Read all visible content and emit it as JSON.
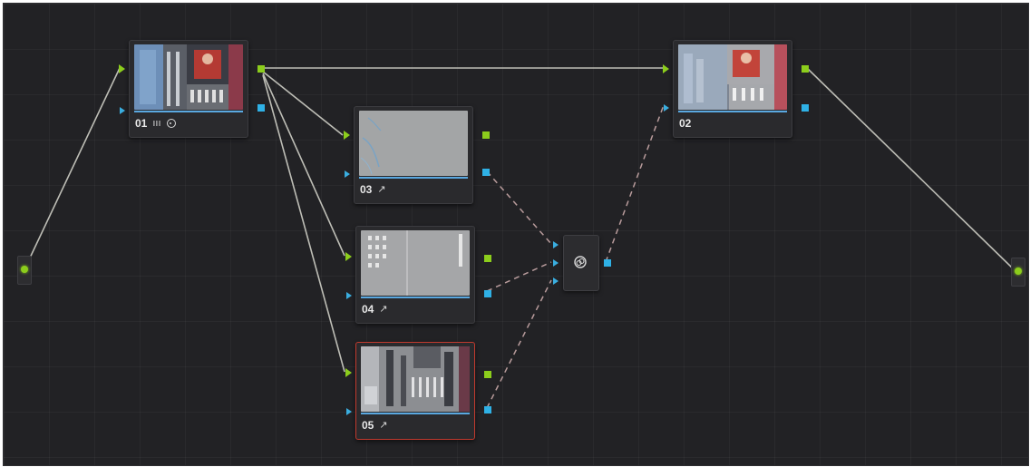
{
  "nodes": [
    {
      "id": "01",
      "number": "01",
      "icons": [
        "bars-icon",
        "circle-target-icon"
      ],
      "selected": false
    },
    {
      "id": "02",
      "number": "02",
      "icons": [],
      "selected": false
    },
    {
      "id": "03",
      "number": "03",
      "icons": [
        "wand-icon"
      ],
      "selected": false
    },
    {
      "id": "04",
      "number": "04",
      "icons": [
        "wand-icon"
      ],
      "selected": false
    },
    {
      "id": "05",
      "number": "05",
      "icons": [
        "wand-icon"
      ],
      "selected": true
    }
  ],
  "glyphs": {
    "bars": "ııı",
    "wand": "↗"
  },
  "colors": {
    "background": "#222225",
    "node": "#2a2a2d",
    "rgb_port": "#8ccd1c",
    "alpha_port": "#2fb1e6",
    "link_rgb": "#cfcfc6",
    "link_key": "#c9a9a9",
    "selected_border": "#c23a2e"
  }
}
